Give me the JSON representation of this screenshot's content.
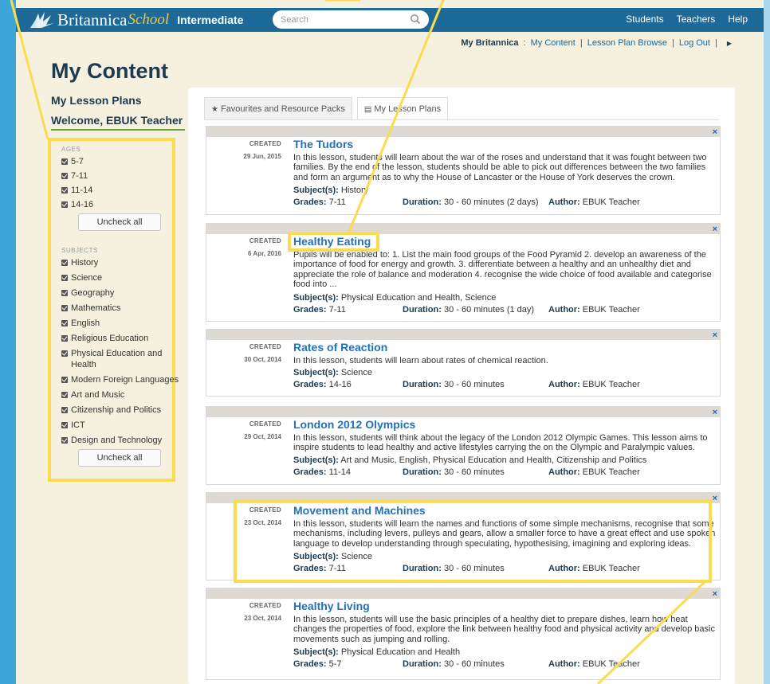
{
  "header": {
    "brand": "Britannica",
    "brand_school": "School",
    "level": "Intermediate",
    "search_placeholder": "Search",
    "nav": [
      "Students",
      "Teachers",
      "Help"
    ]
  },
  "utility": {
    "my_britannica": "My Britannica",
    "colon": ":",
    "links": [
      "My Content",
      "Lesson Plan Browse",
      "Log Out"
    ]
  },
  "page": {
    "title": "My Content",
    "subtitle": "My Lesson Plans",
    "welcome": "Welcome, EBUK Teacher"
  },
  "filters": {
    "ages_heading": "AGES",
    "ages": [
      "5-7",
      "7-11",
      "11-14",
      "14-16"
    ],
    "subjects_heading": "SUBJECTS",
    "subjects": [
      "History",
      "Science",
      "Geography",
      "Mathematics",
      "English",
      "Religious Education",
      "Physical Education and Health",
      "Modern Foreign Languages",
      "Art and Music",
      "Citizenship and Politics",
      "ICT",
      "Design and Technology"
    ],
    "uncheck_label": "Uncheck all"
  },
  "tabs": [
    {
      "icon": "★",
      "label": "Favourites and Resource Packs"
    },
    {
      "icon": "▤",
      "label": "My Lesson Plans"
    }
  ],
  "labels": {
    "created": "CREATED",
    "subjects": "Subject(s):",
    "grades": "Grades:",
    "duration": "Duration:",
    "author": "Author:",
    "close": "×"
  },
  "lessons": [
    {
      "title": "The Tudors",
      "date": "29 Jun, 2015",
      "description": "In this lesson, students will learn about the war of the roses and understand that it was fought between two families. By the end of the lesson, students should be able to pick out differences between the two families and form an argument as to why the House of Lancaster or the House of York deserves the crown.",
      "subjects": "History",
      "grades": "7-11",
      "duration": "30 - 60 minutes (2 days)",
      "author": "EBUK Teacher"
    },
    {
      "title": "Healthy Eating",
      "date": "6 Apr, 2016",
      "description": "Pupils will be enabled to: 1. List the main food groups of the Food Pyramid 2. develop an awareness of the importance of food for energy and growth. 3. differentiate between a healthy and an unhealthy diet and appreciate the role of balance and moderation 4. recognise the wide choice of food available and categorise food into ...",
      "subjects": "Physical Education and Health, Science",
      "grades": "7-11",
      "duration": "30 - 60 minutes (1 day)",
      "author": "EBUK Teacher"
    },
    {
      "title": "Rates of Reaction",
      "date": "30 Oct, 2014",
      "description": "In this lesson, students will learn about rates of chemical reaction.",
      "subjects": "Science",
      "grades": "14-16",
      "duration": "30 - 60 minutes",
      "author": "EBUK Teacher"
    },
    {
      "title": "London 2012 Olympics",
      "date": "29 Oct, 2014",
      "description": "In this lesson, students will think about the legacy of the London 2012 Olympic Games. This lesson aims to inspire students to lead healthy and active lifestyles carrying the on the Olympic and Paralympic values.",
      "subjects": "Art and Music, English, Physical Education and Health, Citizenship and Politics",
      "grades": "11-14",
      "duration": "30 - 60 minutes",
      "author": "EBUK Teacher"
    },
    {
      "title": "Movement and Machines",
      "date": "23 Oct, 2014",
      "description": "In this lesson, students will learn the names and functions of some simple mechanisms, recognise that some mechanisms, including levers, pulleys and gears, allow a smaller force to have a great effect and use spoken language to develop understanding through speculating, hypothesising, imagining and exploring ideas.",
      "subjects": "Science",
      "grades": "7-11",
      "duration": "30 - 60 minutes",
      "author": "EBUK Teacher"
    },
    {
      "title": "Healthy Living",
      "date": "23 Oct, 2014",
      "description": "In this lesson, students will use the basic principles of a healthy diet to prepare dishes, learn how heat changes the properties of food, explore the link between healthy food and physical activity and develop basic movements such as jumping and rolling.",
      "subjects": "Physical Education and Health",
      "grades": "5-7",
      "duration": "30 - 60 minutes",
      "author": "EBUK Teacher"
    }
  ]
}
